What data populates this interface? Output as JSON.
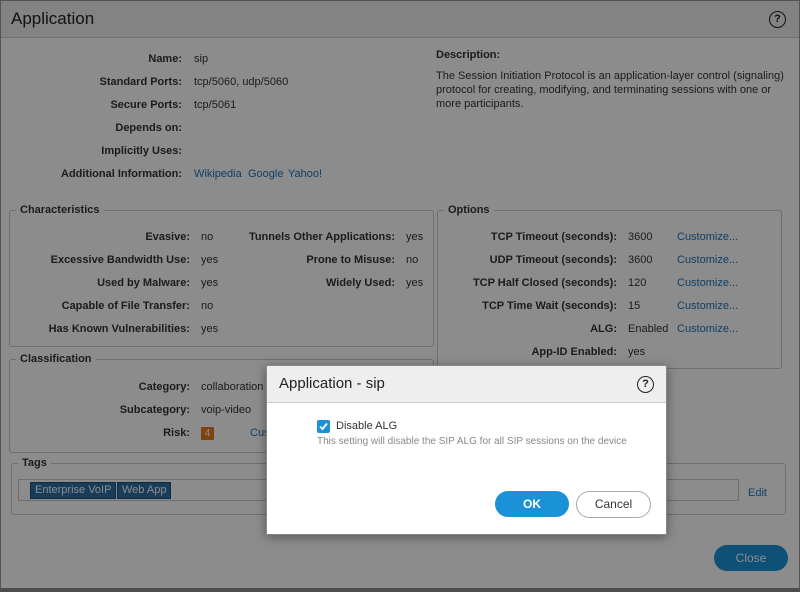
{
  "main": {
    "title": "Application",
    "help_glyph": "?",
    "general": {
      "name_label": "Name:",
      "name_value": "sip",
      "std_ports_label": "Standard Ports:",
      "std_ports_value": "tcp/5060, udp/5060",
      "sec_ports_label": "Secure Ports:",
      "sec_ports_value": "tcp/5061",
      "depends_label": "Depends on:",
      "implicit_label": "Implicitly Uses:",
      "additional_label": "Additional Information:",
      "links": [
        "Wikipedia",
        "Google",
        "Yahoo!"
      ]
    },
    "description": {
      "label": "Description:",
      "text": "The Session Initiation Protocol is an application-layer control (signaling) protocol for creating, modifying, and terminating sessions with one or more participants."
    },
    "characteristics": {
      "legend": "Characteristics",
      "left": [
        {
          "label": "Evasive:",
          "value": "no"
        },
        {
          "label": "Excessive Bandwidth Use:",
          "value": "yes"
        },
        {
          "label": "Used by Malware:",
          "value": "yes"
        },
        {
          "label": "Capable of File Transfer:",
          "value": "no"
        },
        {
          "label": "Has Known Vulnerabilities:",
          "value": "yes"
        }
      ],
      "right": [
        {
          "label": "Tunnels Other Applications:",
          "value": "yes"
        },
        {
          "label": "Prone to Misuse:",
          "value": "no"
        },
        {
          "label": "Widely Used:",
          "value": "yes"
        }
      ]
    },
    "options": {
      "legend": "Options",
      "rows": [
        {
          "label": "TCP Timeout (seconds):",
          "value": "3600",
          "action": "Customize..."
        },
        {
          "label": "UDP Timeout (seconds):",
          "value": "3600",
          "action": "Customize..."
        },
        {
          "label": "TCP Half Closed (seconds):",
          "value": "120",
          "action": "Customize..."
        },
        {
          "label": "TCP Time Wait (seconds):",
          "value": "15",
          "action": "Customize..."
        },
        {
          "label": "ALG:",
          "value": "Enabled",
          "action": "Customize..."
        },
        {
          "label": "App-ID Enabled:",
          "value": "yes",
          "action": ""
        }
      ]
    },
    "classification": {
      "legend": "Classification",
      "category_label": "Category:",
      "category_value": "collaboration",
      "subcategory_label": "Subcategory:",
      "subcategory_value": "voip-video",
      "risk_label": "Risk:",
      "risk_value": "4",
      "risk_action": "Cus",
      "risk_color": "#e87b1e"
    },
    "tags": {
      "legend": "Tags",
      "items": [
        "Enterprise VoIP",
        "Web App"
      ],
      "edit": "Edit"
    },
    "close_label": "Close"
  },
  "modal": {
    "title": "Application - sip",
    "help_glyph": "?",
    "checkbox_label": "Disable ALG",
    "checkbox_checked": true,
    "checkbox_help": "This setting will disable the SIP ALG for all SIP sessions on the device",
    "ok_label": "OK",
    "cancel_label": "Cancel"
  },
  "colors": {
    "accent": "#1b92d8",
    "link": "#1a73b8",
    "tag": "#2e6da4"
  }
}
